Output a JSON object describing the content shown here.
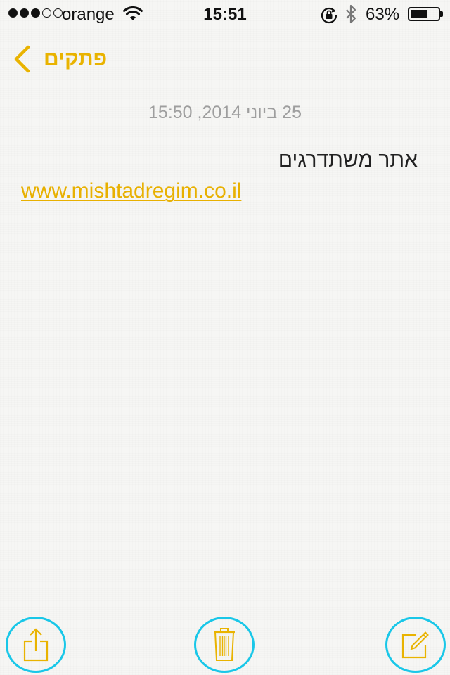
{
  "status_bar": {
    "signal_bars_filled": 3,
    "signal_bars_total": 5,
    "carrier": "orange",
    "time": "15:51",
    "battery_percent_label": "63%",
    "battery_level": 0.63,
    "icons": [
      "wifi-icon",
      "rotation-lock-icon",
      "bluetooth-icon",
      "battery-icon"
    ]
  },
  "nav": {
    "back_label": "פתקים",
    "back_icon": "chevron-left-icon"
  },
  "note": {
    "date": "25 ביוני 2014, 15:50",
    "title": "אתר משתדרגים",
    "link": "www.mishtadregim.co.il"
  },
  "toolbar": {
    "buttons": [
      {
        "icon": "share-icon"
      },
      {
        "icon": "trash-icon"
      },
      {
        "icon": "compose-icon"
      }
    ]
  },
  "colors": {
    "accent": "#e9b300",
    "highlight_circle": "#19c7e8",
    "background": "#f6f6f4",
    "date_text": "#9e9e9e"
  }
}
